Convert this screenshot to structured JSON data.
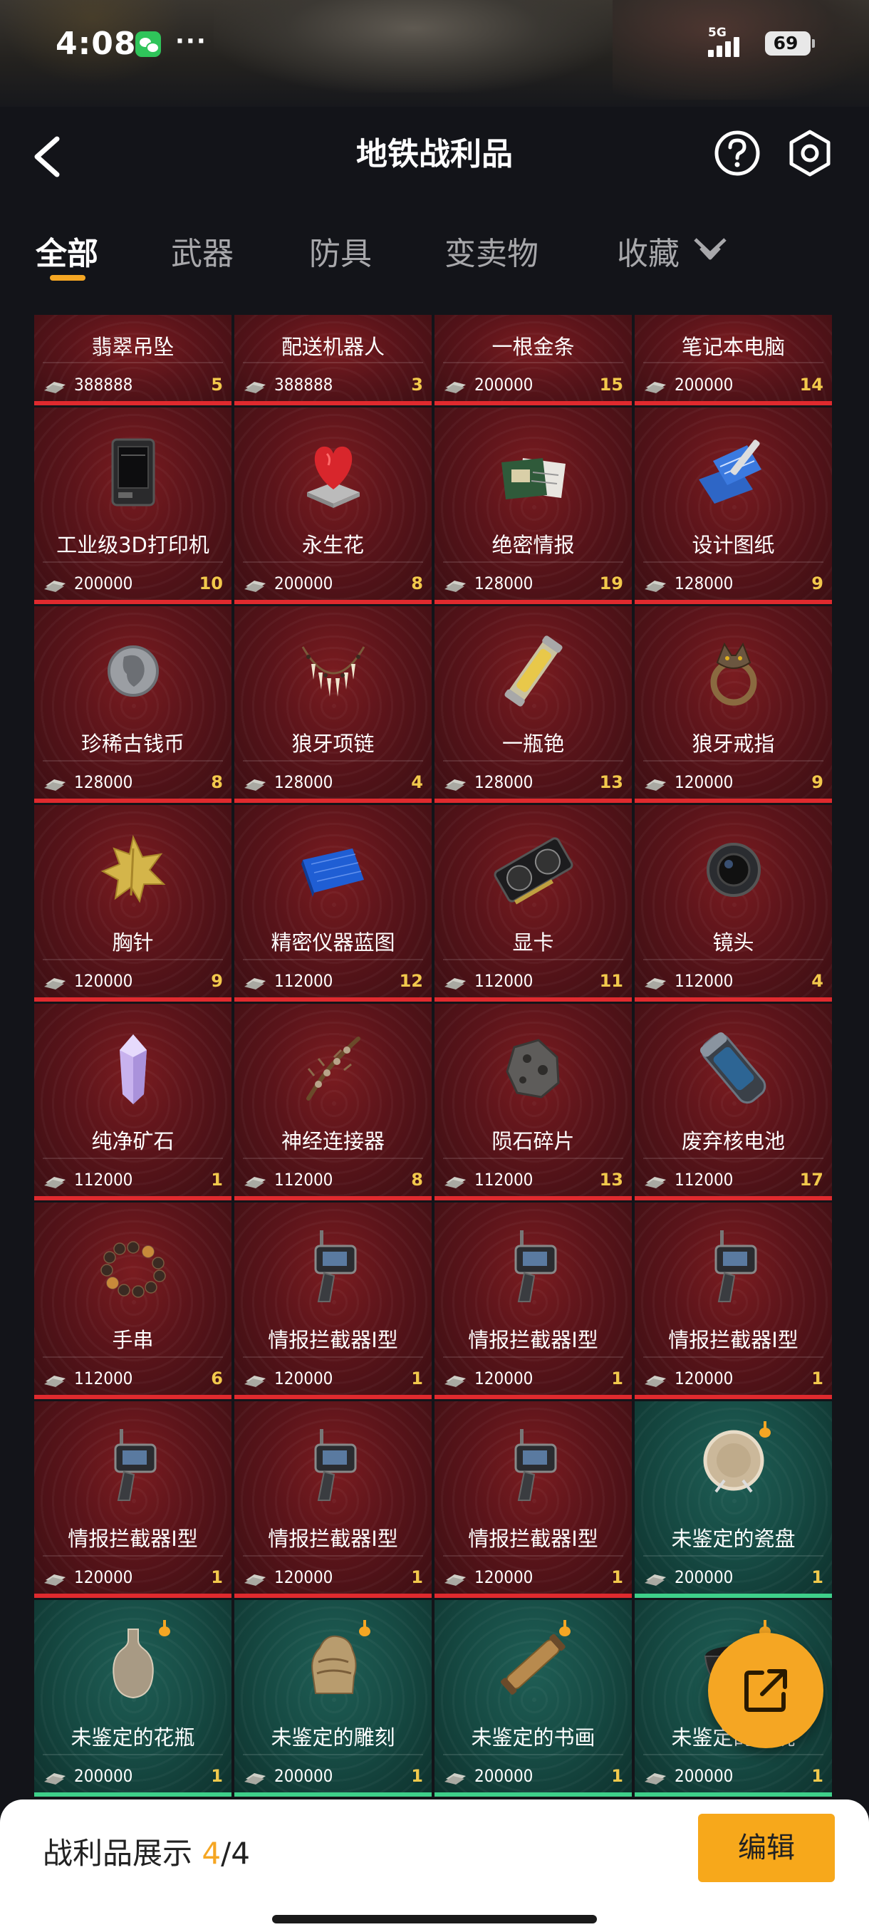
{
  "status_bar": {
    "time": "4:08",
    "more": "···",
    "network": "5G",
    "battery": "69"
  },
  "header": {
    "title": "地铁战利品"
  },
  "tabs": [
    {
      "label": "全部",
      "active": true
    },
    {
      "label": "武器"
    },
    {
      "label": "防具"
    },
    {
      "label": "变卖物"
    },
    {
      "label": "收藏"
    }
  ],
  "colors": {
    "accent": "#f5a623",
    "card_red": "#5a141a",
    "card_teal": "#164a43",
    "count": "#f2c94c"
  },
  "items": [
    {
      "name": "翡翠吊坠",
      "price": "388888",
      "count": "5",
      "rarity": "red",
      "icon": "pendant-icon"
    },
    {
      "name": "配送机器人",
      "price": "388888",
      "count": "3",
      "rarity": "red",
      "icon": "robot-icon"
    },
    {
      "name": "一根金条",
      "price": "200000",
      "count": "15",
      "rarity": "red",
      "icon": "gold-bar-icon"
    },
    {
      "name": "笔记本电脑",
      "price": "200000",
      "count": "14",
      "rarity": "red",
      "icon": "laptop-icon"
    },
    {
      "name": "工业级3D打印机",
      "price": "200000",
      "count": "10",
      "rarity": "red",
      "icon": "3d-printer-icon"
    },
    {
      "name": "永生花",
      "price": "200000",
      "count": "8",
      "rarity": "red",
      "icon": "eternal-flower-icon"
    },
    {
      "name": "绝密情报",
      "price": "128000",
      "count": "19",
      "rarity": "red",
      "icon": "secret-documents-icon"
    },
    {
      "name": "设计图纸",
      "price": "128000",
      "count": "9",
      "rarity": "red",
      "icon": "blueprint-icon"
    },
    {
      "name": "珍稀古钱币",
      "price": "128000",
      "count": "8",
      "rarity": "red",
      "icon": "ancient-coin-icon"
    },
    {
      "name": "狼牙项链",
      "price": "128000",
      "count": "4",
      "rarity": "red",
      "icon": "fang-necklace-icon"
    },
    {
      "name": "一瓶铯",
      "price": "128000",
      "count": "13",
      "rarity": "red",
      "icon": "cesium-vial-icon"
    },
    {
      "name": "狼牙戒指",
      "price": "120000",
      "count": "9",
      "rarity": "red",
      "icon": "wolf-ring-icon"
    },
    {
      "name": "胸针",
      "price": "120000",
      "count": "9",
      "rarity": "red",
      "icon": "leaf-brooch-icon"
    },
    {
      "name": "精密仪器蓝图",
      "price": "112000",
      "count": "12",
      "rarity": "red",
      "icon": "instrument-blueprint-icon"
    },
    {
      "name": "显卡",
      "price": "112000",
      "count": "11",
      "rarity": "red",
      "icon": "graphics-card-icon"
    },
    {
      "name": "镜头",
      "price": "112000",
      "count": "4",
      "rarity": "red",
      "icon": "camera-lens-icon"
    },
    {
      "name": "纯净矿石",
      "price": "112000",
      "count": "1",
      "rarity": "red",
      "icon": "crystal-icon"
    },
    {
      "name": "神经连接器",
      "price": "112000",
      "count": "8",
      "rarity": "red",
      "icon": "neural-connector-icon"
    },
    {
      "name": "陨石碎片",
      "price": "112000",
      "count": "13",
      "rarity": "red",
      "icon": "meteorite-icon"
    },
    {
      "name": "废弃核电池",
      "price": "112000",
      "count": "17",
      "rarity": "red",
      "icon": "nuclear-battery-icon"
    },
    {
      "name": "手串",
      "price": "112000",
      "count": "6",
      "rarity": "red",
      "icon": "bead-bracelet-icon"
    },
    {
      "name": "情报拦截器I型",
      "price": "120000",
      "count": "1",
      "rarity": "red",
      "icon": "intercept-device-icon"
    },
    {
      "name": "情报拦截器I型",
      "price": "120000",
      "count": "1",
      "rarity": "red",
      "icon": "intercept-device-icon"
    },
    {
      "name": "情报拦截器I型",
      "price": "120000",
      "count": "1",
      "rarity": "red",
      "icon": "intercept-device-icon"
    },
    {
      "name": "情报拦截器I型",
      "price": "120000",
      "count": "1",
      "rarity": "red",
      "icon": "intercept-device-icon"
    },
    {
      "name": "情报拦截器I型",
      "price": "120000",
      "count": "1",
      "rarity": "red",
      "icon": "intercept-device-icon"
    },
    {
      "name": "情报拦截器I型",
      "price": "120000",
      "count": "1",
      "rarity": "red",
      "icon": "intercept-device-icon"
    },
    {
      "name": "未鉴定的瓷盘",
      "price": "200000",
      "count": "1",
      "rarity": "teal",
      "icon": "porcelain-plate-icon",
      "flag": true
    },
    {
      "name": "未鉴定的花瓶",
      "price": "200000",
      "count": "1",
      "rarity": "teal",
      "icon": "vase-icon",
      "flag": true
    },
    {
      "name": "未鉴定的雕刻",
      "price": "200000",
      "count": "1",
      "rarity": "teal",
      "icon": "carving-icon",
      "flag": true
    },
    {
      "name": "未鉴定的书画",
      "price": "200000",
      "count": "1",
      "rarity": "teal",
      "icon": "scroll-icon",
      "flag": true
    },
    {
      "name": "未鉴定的瓷碗",
      "price": "200000",
      "count": "1",
      "rarity": "teal",
      "icon": "porcelain-bowl-icon",
      "flag": true
    }
  ],
  "showcase": {
    "label": "战利品展示",
    "current": "4",
    "total": "/4"
  },
  "edit_button": {
    "label": "编辑"
  }
}
